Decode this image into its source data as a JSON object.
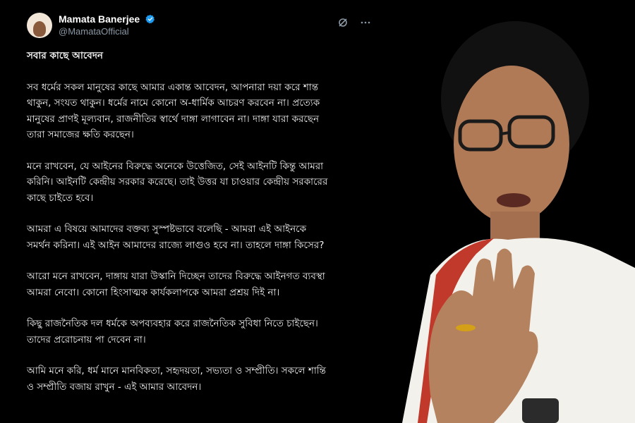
{
  "author": {
    "display_name": "Mamata Banerjee",
    "handle": "@MamataOfficial"
  },
  "icons": {
    "verified": "verified-badge-icon",
    "grok": "grok-icon",
    "more": "more-options-icon"
  },
  "colors": {
    "verified": "#1d9bf0",
    "background": "#000000"
  },
  "post": {
    "title": "সবার কাছে আবেদন",
    "paragraphs": [
      "সব ধর্মের সকল মানুষের কাছে আমার একান্ত আবেদন, আপনারা দয়া করে শান্ত\nথাকুন, সংযত থাকুন। ধর্মের নামে কোনো অ-ধার্মিক আচরণ করবেন না। প্রত্যেক\nমানুষের প্রাণই মূল্যবান,  রাজনীতির স্বার্থে দাঙ্গা লাগাবেন না। দাঙ্গা যারা করছেন\nতারা সমাজের ক্ষতি করছেন।",
      "মনে রাখবেন, যে আইনের বিরুদ্ধে অনেকে উত্তেজিত, সেই আইনটি কিন্তু আমরা\nকরিনি। আইনটি কেন্দ্রীয় সরকার করেছে। তাই উত্তর যা চাওয়ার কেন্দ্রীয় সরকারের\nকাছে চাইতে হবে।",
      "আমরা এ বিষয়ে আমাদের বক্তব্য সুস্পষ্টভাবে বলেছি - আমরা এই আইনকে\nসমর্থন করিনা। এই আইন আমাদের রাজ্যে লাগুও হবে না। তাহলে দাঙ্গা কিসের?",
      "আরো মনে রাখবেন, দাঙ্গায় যারা উস্কানি দিচ্ছেন তাদের বিরুদ্ধে আইনগত ব্যবস্থা\nআমরা নেবো। কোনো হিংসাত্মক কার্যকলাপকে আমরা প্রশ্রয় দিই না।",
      "কিছু রাজনৈতিক দল ধর্মকে অপব্যবহার করে রাজনৈতিক সুবিধা নিতে চাইছেন।\nতাদের প্ররোচনায় পা দেবেন না।",
      "আমি মনে করি, ধর্ম মানে মানবিকতা, সহৃদয়তা, সভ্যতা ও সম্প্রীতি। সকলে শান্তি\nও সম্প্রীতি বজায় রাখুন - এই আমার আবেদন।"
    ]
  }
}
